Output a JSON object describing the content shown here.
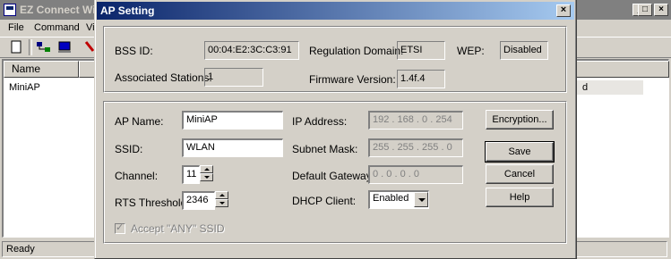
{
  "main": {
    "title": "EZ Connect Wi",
    "menu": [
      "File",
      "Command",
      "Vi"
    ],
    "columns": [
      "Name"
    ],
    "row": {
      "name": "MiniAP",
      "tail": "d"
    },
    "status": "Ready",
    "window_buttons": {
      "minimize": "_",
      "maximize": "□",
      "close": "×"
    }
  },
  "dialog": {
    "title": "AP Setting",
    "close": "×",
    "info": {
      "bss_id_label": "BSS ID:",
      "bss_id": "00:04:E2:3C:C3:91",
      "regulation_label": "Regulation Domain:",
      "regulation": "ETSI",
      "wep_label": "WEP:",
      "wep": "Disabled",
      "stations_label": "Associated Stations:",
      "stations": "1",
      "firmware_label": "Firmware Version:",
      "firmware": "1.4f.4"
    },
    "settings": {
      "ap_name_label": "AP Name:",
      "ap_name": "MiniAP",
      "ssid_label": "SSID:",
      "ssid": "WLAN",
      "channel_label": "Channel:",
      "channel": "11",
      "rts_label": "RTS Threshold:",
      "rts": "2346",
      "accept_any_label": "Accept \"ANY\" SSID",
      "ip_label": "IP Address:",
      "ip": "192 . 168 .  0  . 254",
      "subnet_label": "Subnet Mask:",
      "subnet": "255 . 255 . 255 .  0",
      "gateway_label": "Default Gateway:",
      "gateway": "0  .  0  .  0  .  0",
      "dhcp_label": "DHCP Client:",
      "dhcp": "Enabled"
    },
    "buttons": {
      "encryption": "Encryption...",
      "save": "Save",
      "cancel": "Cancel",
      "help": "Help"
    }
  }
}
